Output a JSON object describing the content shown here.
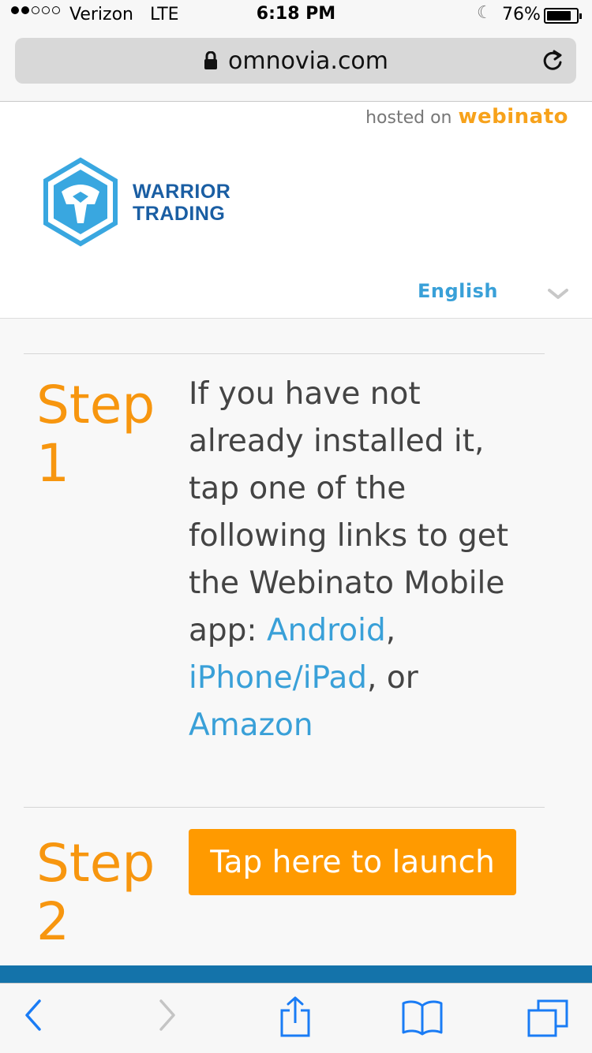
{
  "status_bar": {
    "carrier": "Verizon",
    "network": "LTE",
    "time": "6:18 PM",
    "battery_percent": "76%",
    "signal_bars_filled": 2,
    "signal_bars_total": 5
  },
  "browser": {
    "url": "omnovia.com",
    "lock_icon": "lock-icon",
    "reload_icon": "reload-icon"
  },
  "header": {
    "hosted_prefix": "hosted on",
    "hosted_brand": "webinato",
    "logo_line1": "WARRIOR",
    "logo_line2": "TRADING",
    "language": "English"
  },
  "steps": [
    {
      "label_word": "Step",
      "label_num": "1",
      "text_before": "If you have not already installed it, tap one of the following links to get the Webinato Mobile app: ",
      "link_android": "Android",
      "sep1": ", ",
      "link_iphone": "iPhone/iPad",
      "sep2": ", or ",
      "link_amazon": "Amazon"
    },
    {
      "label_word": "Step",
      "label_num": "2",
      "button_label": "Tap here to launch"
    }
  ],
  "colors": {
    "accent_orange": "#f7960f",
    "button_orange": "#ff9a00",
    "link_blue": "#39a0d8",
    "band_blue": "#1473aa"
  }
}
